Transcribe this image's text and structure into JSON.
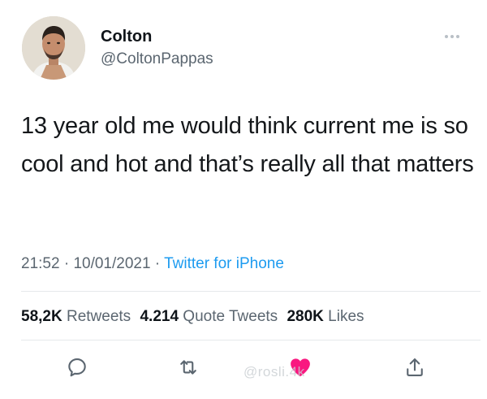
{
  "user": {
    "display_name": "Colton",
    "handle": "@ColtonPappas"
  },
  "tweet": {
    "text": "13 year old me would think current me is so cool and hot and that’s really all that matters"
  },
  "meta": {
    "time": "21:52",
    "date": "10/01/2021",
    "source": "Twitter for iPhone",
    "separator": " · "
  },
  "stats": {
    "retweets_count": "58,2K",
    "retweets_label": "Retweets",
    "quotes_count": "4.214",
    "quotes_label": "Quote Tweets",
    "likes_count": "280K",
    "likes_label": "Likes"
  },
  "watermark": {
    "text": "@rosli.4k"
  },
  "colors": {
    "link_blue": "#1d9bf0",
    "like_red": "#f91880",
    "secondary_text": "#5b6670"
  },
  "icons": {
    "reply": "reply-icon",
    "retweet": "retweet-icon",
    "like": "heart-icon",
    "share": "share-icon",
    "more": "more-icon"
  }
}
